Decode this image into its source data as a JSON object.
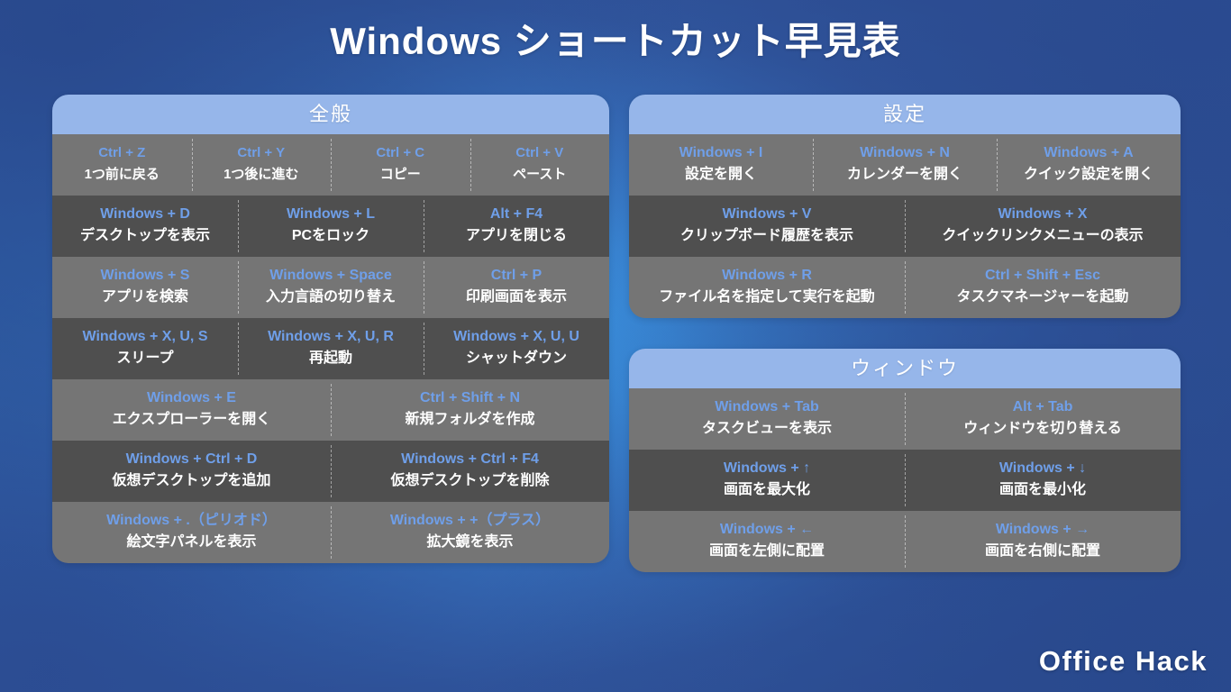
{
  "page": {
    "title": "Windows ショートカット早見表",
    "logo": "Office Hack",
    "colors": {
      "accent_key": "#6f9fe9",
      "card_header": "#96b6ea",
      "row_light": "#757575",
      "row_dark": "#4f4f4f",
      "bg_dark_blue": "#2f5499",
      "bg_bright_blue": "#3b9ae8",
      "text": "#ffffff"
    }
  },
  "cards": [
    {
      "id": "general",
      "header": "全般",
      "rows": [
        {
          "shade": "light",
          "cells": [
            {
              "keys": "Ctrl + Z",
              "desc": "1つ前に戻る"
            },
            {
              "keys": "Ctrl + Y",
              "desc": "1つ後に進む"
            },
            {
              "keys": "Ctrl + C",
              "desc": "コピー"
            },
            {
              "keys": "Ctrl + V",
              "desc": "ペースト"
            }
          ]
        },
        {
          "shade": "dark",
          "cells": [
            {
              "keys": "Windows + D",
              "desc": "デスクトップを表示"
            },
            {
              "keys": "Windows + L",
              "desc": "PCをロック"
            },
            {
              "keys": "Alt + F4",
              "desc": "アプリを閉じる"
            }
          ]
        },
        {
          "shade": "light",
          "cells": [
            {
              "keys": "Windows + S",
              "desc": "アプリを検索"
            },
            {
              "keys": "Windows + Space",
              "desc": "入力言語の切り替え"
            },
            {
              "keys": "Ctrl + P",
              "desc": "印刷画面を表示"
            }
          ]
        },
        {
          "shade": "dark",
          "cells": [
            {
              "keys": "Windows + X, U, S",
              "desc": "スリープ"
            },
            {
              "keys": "Windows + X, U, R",
              "desc": "再起動"
            },
            {
              "keys": "Windows + X, U, U",
              "desc": "シャットダウン"
            }
          ]
        },
        {
          "shade": "light",
          "cells": [
            {
              "keys": "Windows + E",
              "desc": "エクスプローラーを開く"
            },
            {
              "keys": "Ctrl + Shift + N",
              "desc": "新規フォルダを作成"
            }
          ]
        },
        {
          "shade": "dark",
          "cells": [
            {
              "keys": "Windows + Ctrl + D",
              "desc": "仮想デスクトップを追加"
            },
            {
              "keys": "Windows + Ctrl + F4",
              "desc": "仮想デスクトップを削除"
            }
          ]
        },
        {
          "shade": "light",
          "cells": [
            {
              "keys": "Windows + .（ピリオド）",
              "desc": "絵文字パネルを表示"
            },
            {
              "keys": "Windows + +（プラス）",
              "desc": "拡大鏡を表示"
            }
          ]
        }
      ]
    },
    {
      "id": "settings",
      "header": "設定",
      "rows": [
        {
          "shade": "light",
          "cells": [
            {
              "keys": "Windows + I",
              "desc": "設定を開く"
            },
            {
              "keys": "Windows + N",
              "desc": "カレンダーを開く"
            },
            {
              "keys": "Windows + A",
              "desc": "クイック設定を開く"
            }
          ]
        },
        {
          "shade": "dark",
          "cells": [
            {
              "keys": "Windows + V",
              "desc": "クリップボード履歴を表示"
            },
            {
              "keys": "Windows + X",
              "desc": "クイックリンクメニューの表示"
            }
          ]
        },
        {
          "shade": "light",
          "cells": [
            {
              "keys": "Windows + R",
              "desc": "ファイル名を指定して実行を起動"
            },
            {
              "keys": "Ctrl + Shift + Esc",
              "desc": "タスクマネージャーを起動"
            }
          ]
        }
      ]
    },
    {
      "id": "window",
      "header": "ウィンドウ",
      "rows": [
        {
          "shade": "light",
          "cells": [
            {
              "keys": "Windows + Tab",
              "desc": "タスクビューを表示"
            },
            {
              "keys": "Alt + Tab",
              "desc": "ウィンドウを切り替える"
            }
          ]
        },
        {
          "shade": "dark",
          "cells": [
            {
              "keys": "Windows + ↑",
              "desc": "画面を最大化"
            },
            {
              "keys": "Windows + ↓",
              "desc": "画面を最小化"
            }
          ]
        },
        {
          "shade": "light",
          "cells": [
            {
              "keys": "Windows + ←",
              "desc": "画面を左側に配置"
            },
            {
              "keys": "Windows + →",
              "desc": "画面を右側に配置"
            }
          ]
        }
      ]
    }
  ]
}
